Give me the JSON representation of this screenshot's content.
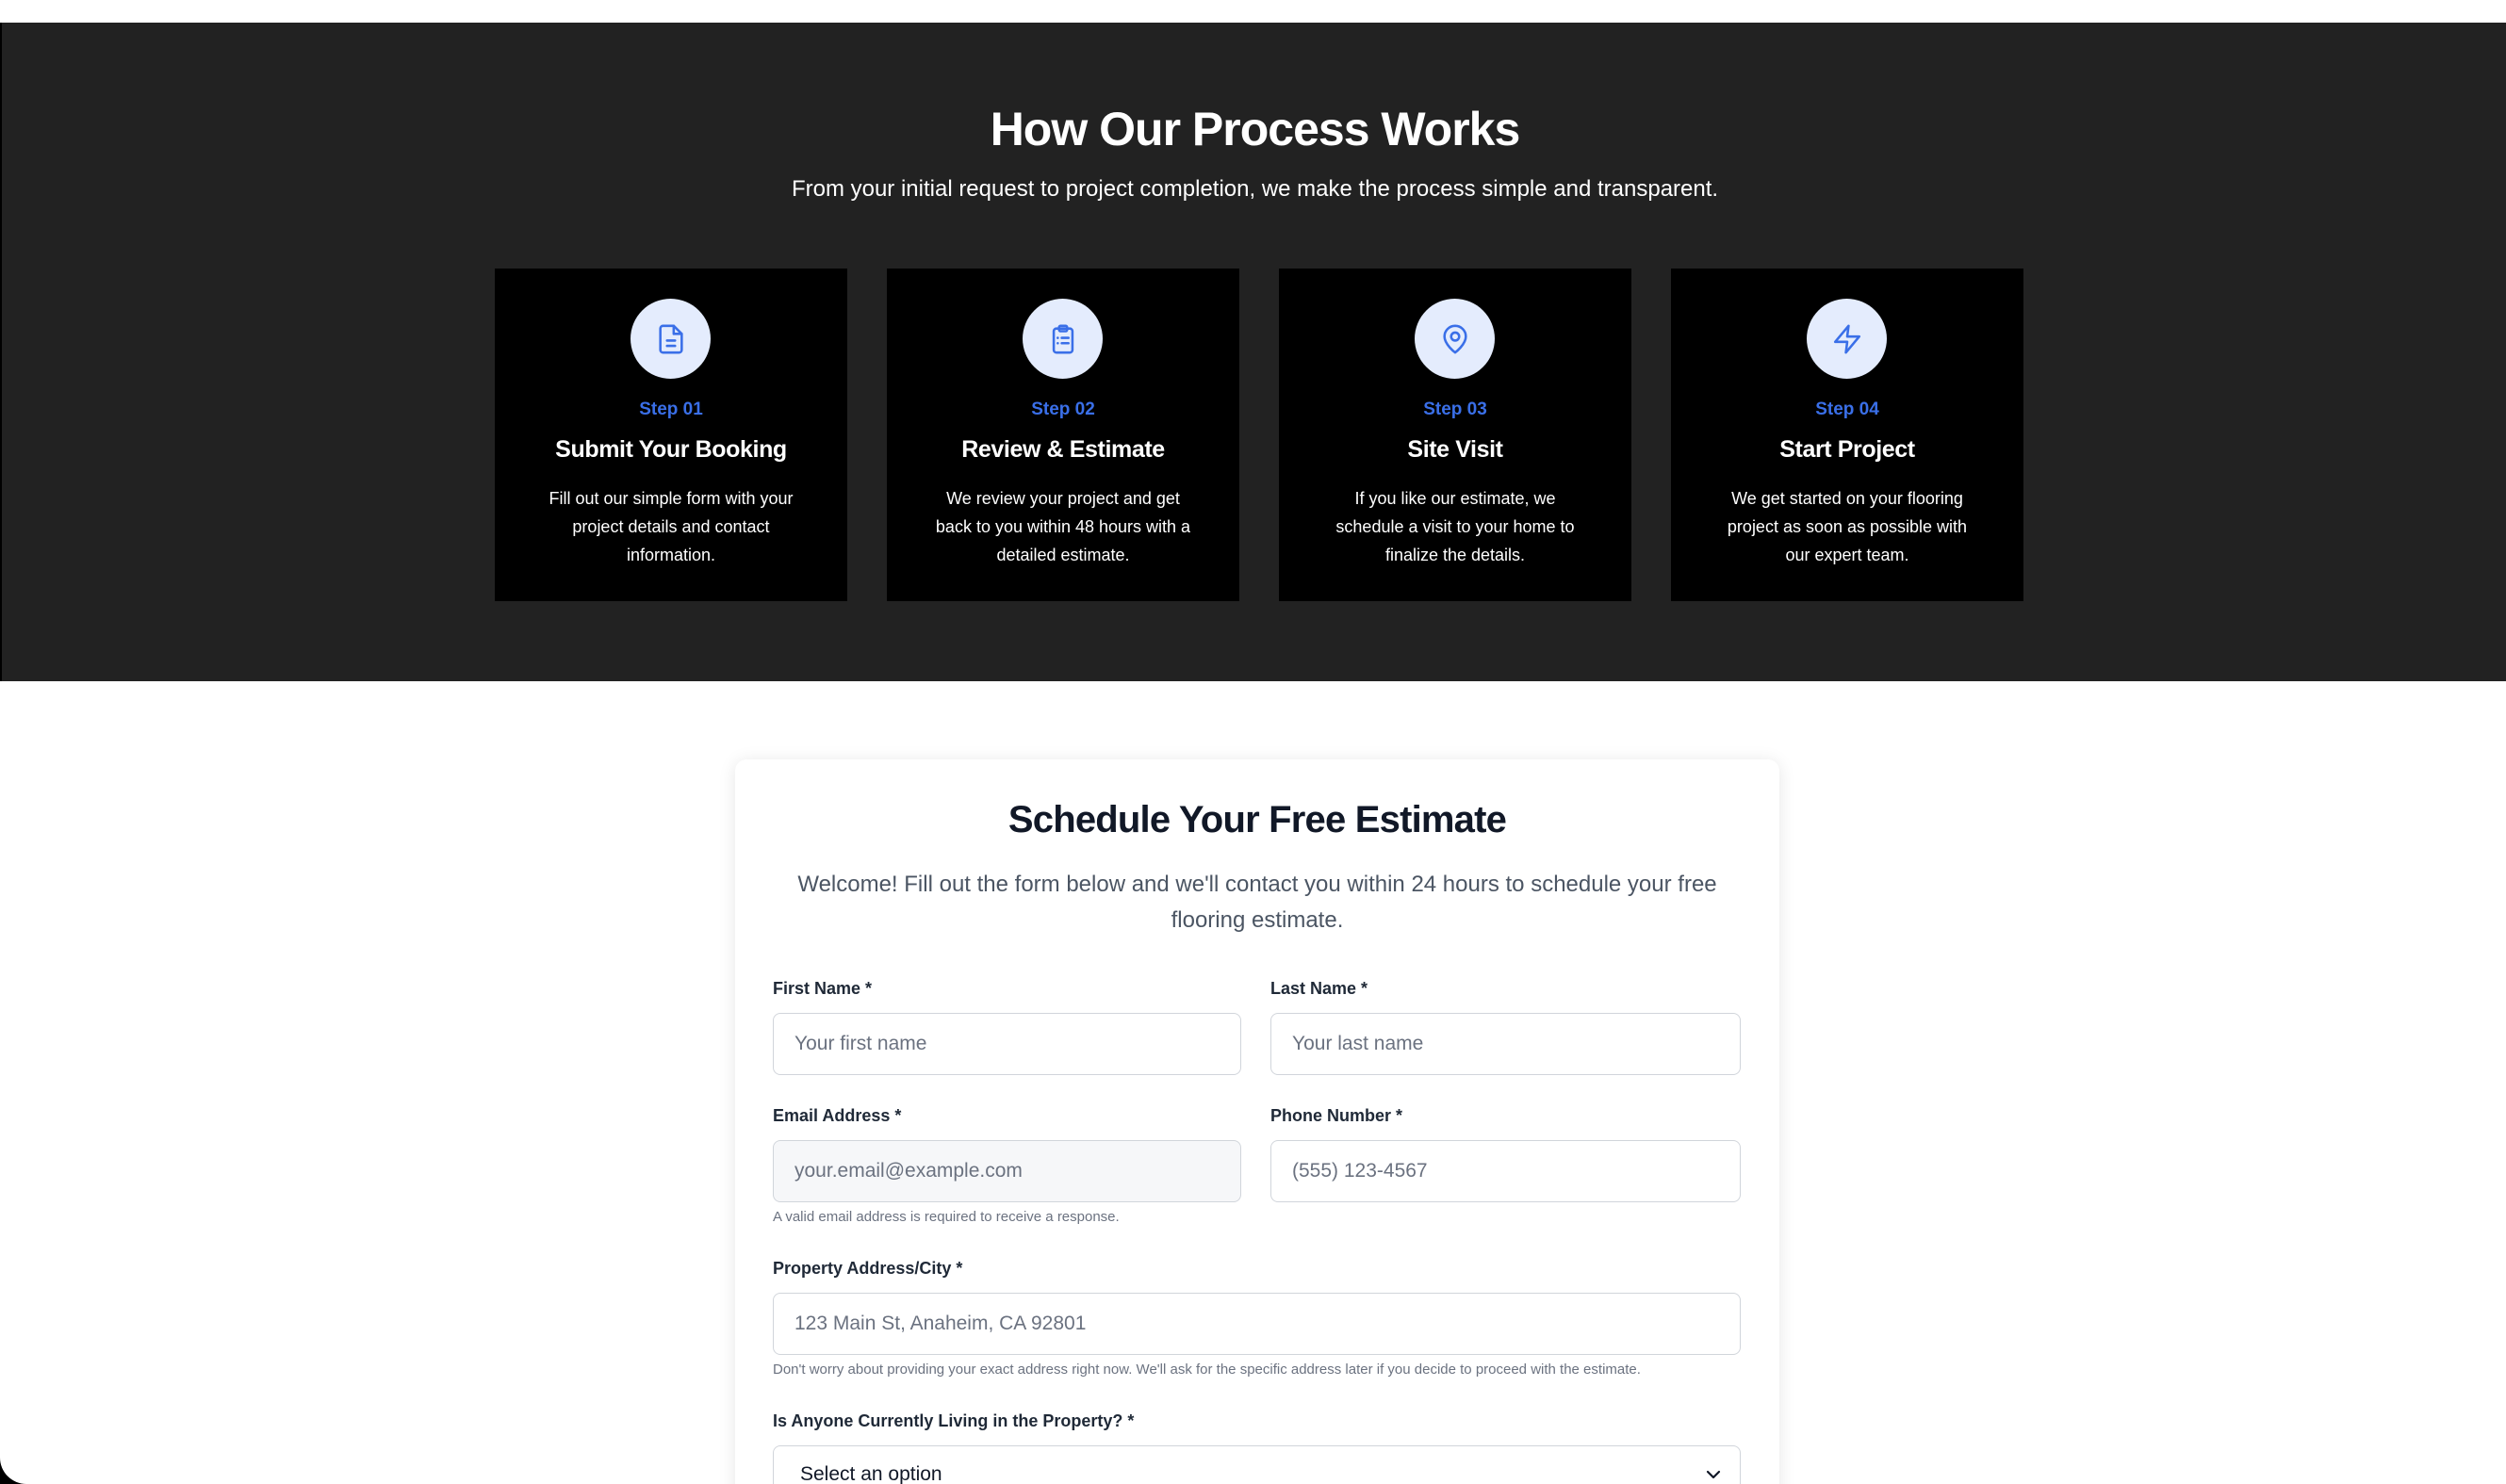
{
  "colors": {
    "section_bg": "#222222",
    "card_bg": "#000000",
    "accent": "#3a6fe8",
    "icon_circle_bg": "#e4ecfd"
  },
  "process": {
    "title": "How Our Process Works",
    "subtitle": "From your initial request to project completion, we make the process simple and transparent.",
    "steps": [
      {
        "icon": "document-icon",
        "step": "Step 01",
        "title": "Submit Your Booking",
        "description": "Fill out our simple form with your project details and contact information."
      },
      {
        "icon": "clipboard-list-icon",
        "step": "Step 02",
        "title": "Review & Estimate",
        "description": "We review your project and get back to you within 48 hours with a detailed estimate."
      },
      {
        "icon": "map-pin-icon",
        "step": "Step 03",
        "title": "Site Visit",
        "description": "If you like our estimate, we schedule a visit to your home to finalize the details."
      },
      {
        "icon": "lightning-icon",
        "step": "Step 04",
        "title": "Start Project",
        "description": "We get started on your flooring project as soon as possible with our expert team."
      }
    ]
  },
  "form": {
    "title": "Schedule Your Free Estimate",
    "intro": "Welcome! Fill out the form below and we'll contact you within 24 hours to schedule your free flooring estimate.",
    "first_name": {
      "label": "First Name *",
      "placeholder": "Your first name"
    },
    "last_name": {
      "label": "Last Name *",
      "placeholder": "Your last name"
    },
    "email": {
      "label": "Email Address *",
      "placeholder": "your.email@example.com",
      "help": "A valid email address is required to receive a response."
    },
    "phone": {
      "label": "Phone Number *",
      "placeholder": "(555) 123-4567"
    },
    "address": {
      "label": "Property Address/City *",
      "placeholder": "123 Main St, Anaheim, CA 92801",
      "help": "Don't worry about providing your exact address right now. We'll ask for the specific address later if you decide to proceed with the estimate."
    },
    "occupancy": {
      "label": "Is Anyone Currently Living in the Property? *",
      "selected": "Select an option",
      "icon": "chevron-down-icon"
    }
  }
}
